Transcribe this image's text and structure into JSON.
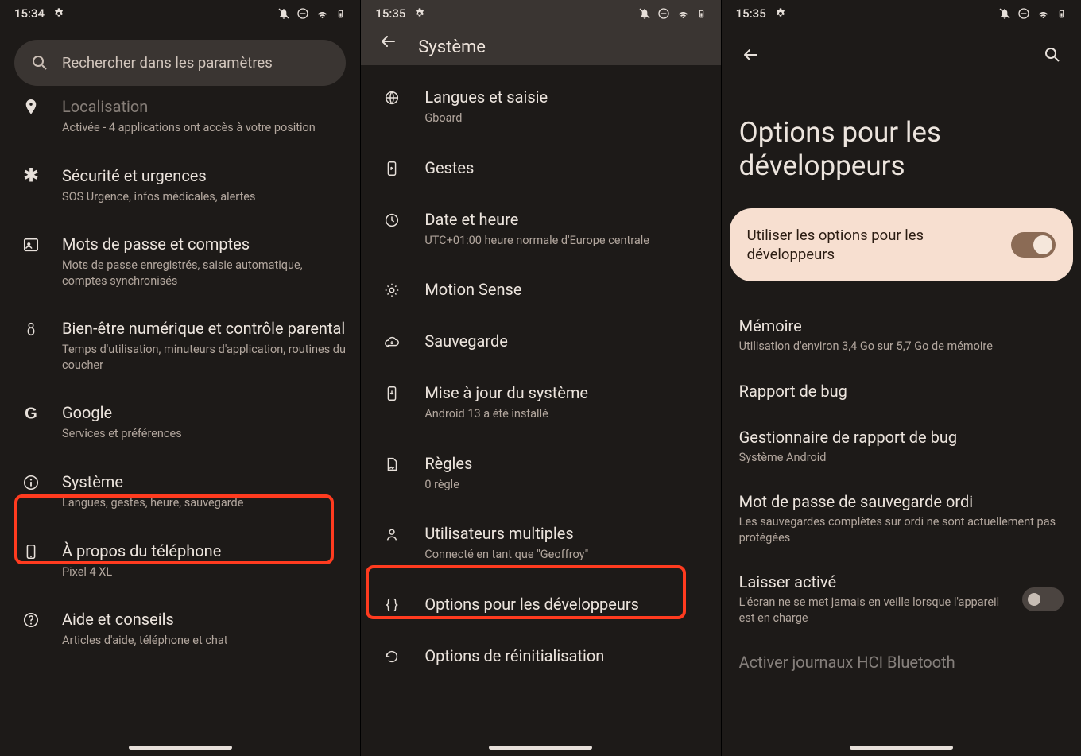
{
  "status": {
    "time1": "15:34",
    "time2": "15:35",
    "time3": "15:35"
  },
  "screen1": {
    "search_placeholder": "Rechercher dans les paramètres",
    "rows": [
      {
        "title": "Localisation",
        "sub": "Activée - 4 applications ont accès à votre position"
      },
      {
        "title": "Sécurité et urgences",
        "sub": "SOS Urgence, infos médicales, alertes"
      },
      {
        "title": "Mots de passe et comptes",
        "sub": "Mots de passe enregistrés, saisie automatique, comptes synchronisés"
      },
      {
        "title": "Bien-être numérique et contrôle parental",
        "sub": "Temps d'utilisation, minuteurs d'application, routines du coucher"
      },
      {
        "title": "Google",
        "sub": "Services et préférences"
      },
      {
        "title": "Système",
        "sub": "Langues, gestes, heure, sauvegarde"
      },
      {
        "title": "À propos du téléphone",
        "sub": "Pixel 4 XL"
      },
      {
        "title": "Aide et conseils",
        "sub": "Articles d'aide, téléphone et chat"
      }
    ]
  },
  "screen2": {
    "title": "Système",
    "rows": [
      {
        "title": "Langues et saisie",
        "sub": "Gboard"
      },
      {
        "title": "Gestes",
        "sub": ""
      },
      {
        "title": "Date et heure",
        "sub": "UTC+01:00 heure normale d'Europe centrale"
      },
      {
        "title": "Motion Sense",
        "sub": ""
      },
      {
        "title": "Sauvegarde",
        "sub": ""
      },
      {
        "title": "Mise à jour du système",
        "sub": "Android 13 a été installé"
      },
      {
        "title": "Règles",
        "sub": "0 règle"
      },
      {
        "title": "Utilisateurs multiples",
        "sub": "Connecté en tant que \"Geoffroy\""
      },
      {
        "title": "Options pour les développeurs",
        "sub": ""
      },
      {
        "title": "Options de réinitialisation",
        "sub": ""
      }
    ]
  },
  "screen3": {
    "title": "Options pour les développeurs",
    "master_toggle_label": "Utiliser les options pour les développeurs",
    "rows": [
      {
        "title": "Mémoire",
        "sub": "Utilisation d'environ 3,4 Go sur 5,7 Go de mémoire"
      },
      {
        "title": "Rapport de bug",
        "sub": ""
      },
      {
        "title": "Gestionnaire de rapport de bug",
        "sub": "Système Android"
      },
      {
        "title": "Mot de passe de sauvegarde ordi",
        "sub": "Les sauvegardes complètes sur ordi ne sont actuellement pas protégées"
      },
      {
        "title": "Laisser activé",
        "sub": "L'écran ne se met jamais en veille lorsque l'appareil est en charge",
        "toggle": true
      },
      {
        "title": "Activer journaux HCI Bluetooth",
        "sub": ""
      }
    ]
  }
}
